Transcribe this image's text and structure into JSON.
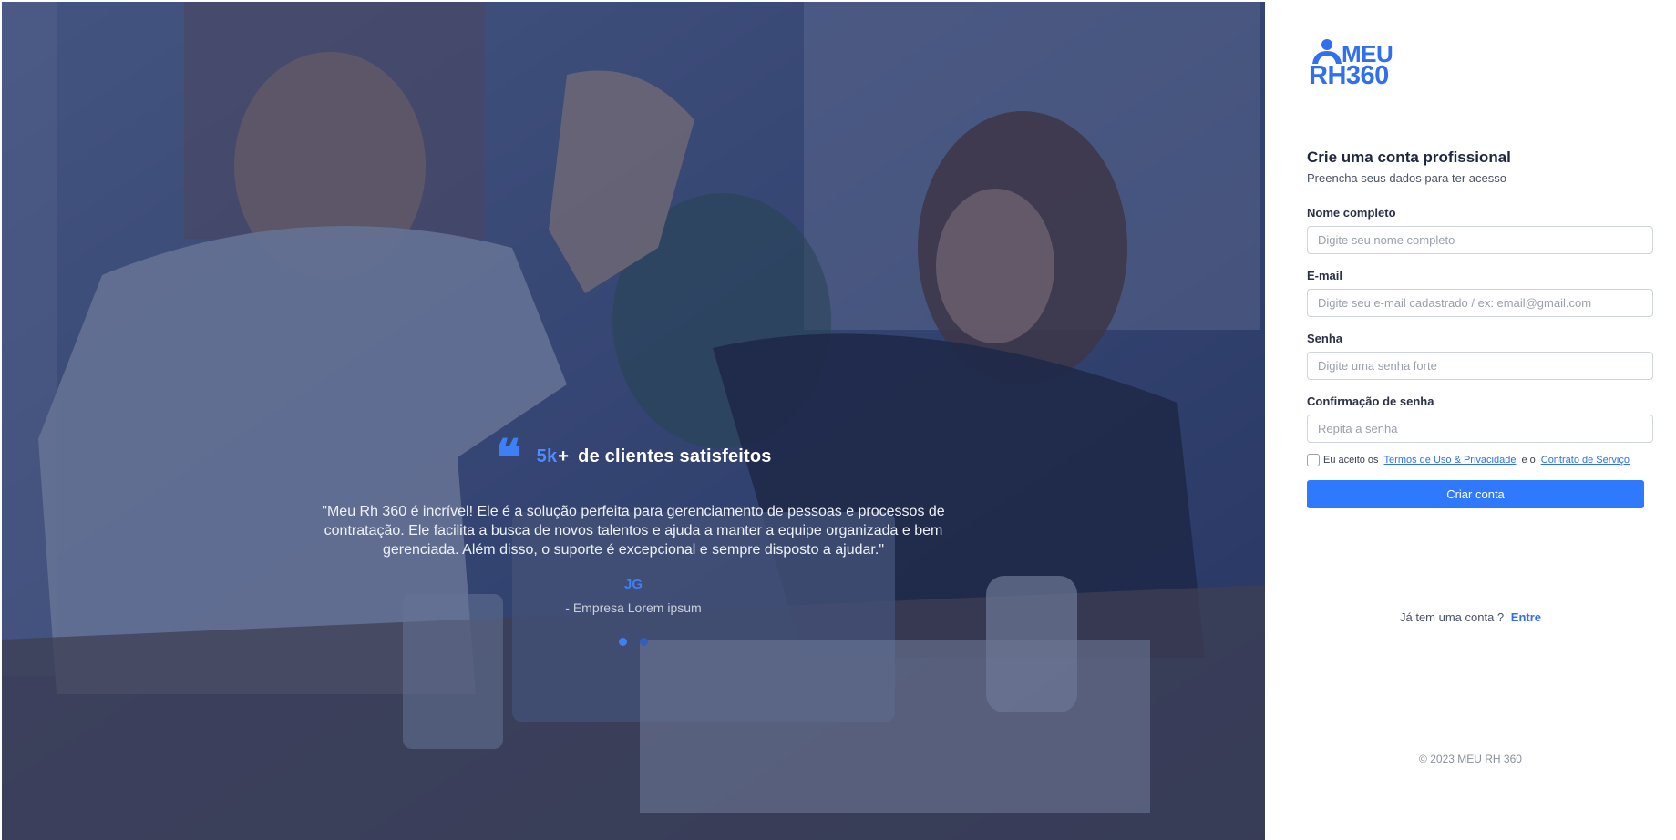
{
  "hero": {
    "stat_number": "5k",
    "stat_plus": "+",
    "stat_label": "de clientes satisfeitos",
    "quote": "\"Meu Rh 360 é incrível! Ele é a solução perfeita para gerenciamento de pessoas e processos de contratação. Ele facilita a busca de novos talentos e ajuda a manter a equipe organizada e bem gerenciada. Além disso, o suporte é excepcional e sempre disposto a ajudar.\"",
    "author_initials": "JG",
    "author_company": "- Empresa Lorem ipsum",
    "carousel": {
      "total": 2,
      "active": 1
    }
  },
  "brand": {
    "logo_line1": "MEU",
    "logo_line2": "RH360",
    "accent_color": "#2f6ff0"
  },
  "form": {
    "title": "Crie uma conta profissional",
    "subtitle": "Preencha seus dados para ter acesso",
    "fields": [
      {
        "label": "Nome completo",
        "placeholder": "Digite seu nome completo",
        "value": ""
      },
      {
        "label": "E-mail",
        "placeholder": "Digite seu e-mail cadastrado / ex: email@gmail.com",
        "value": ""
      },
      {
        "label": "Senha",
        "placeholder": "Digite uma senha forte",
        "value": ""
      },
      {
        "label": "Confirmação de senha",
        "placeholder": "Repita a senha",
        "value": ""
      }
    ],
    "terms": {
      "prefix": "Eu aceito os",
      "terms_link": "Termos de Uso & Privacidade",
      "joiner": "e  o",
      "contract_link": "Contrato de Serviço",
      "checked": false
    },
    "submit_label": "Criar conta"
  },
  "login": {
    "prompt": "Já tem uma conta ?",
    "link": "Entre"
  },
  "footer": {
    "copyright": "© 2023 MEU RH 360"
  }
}
